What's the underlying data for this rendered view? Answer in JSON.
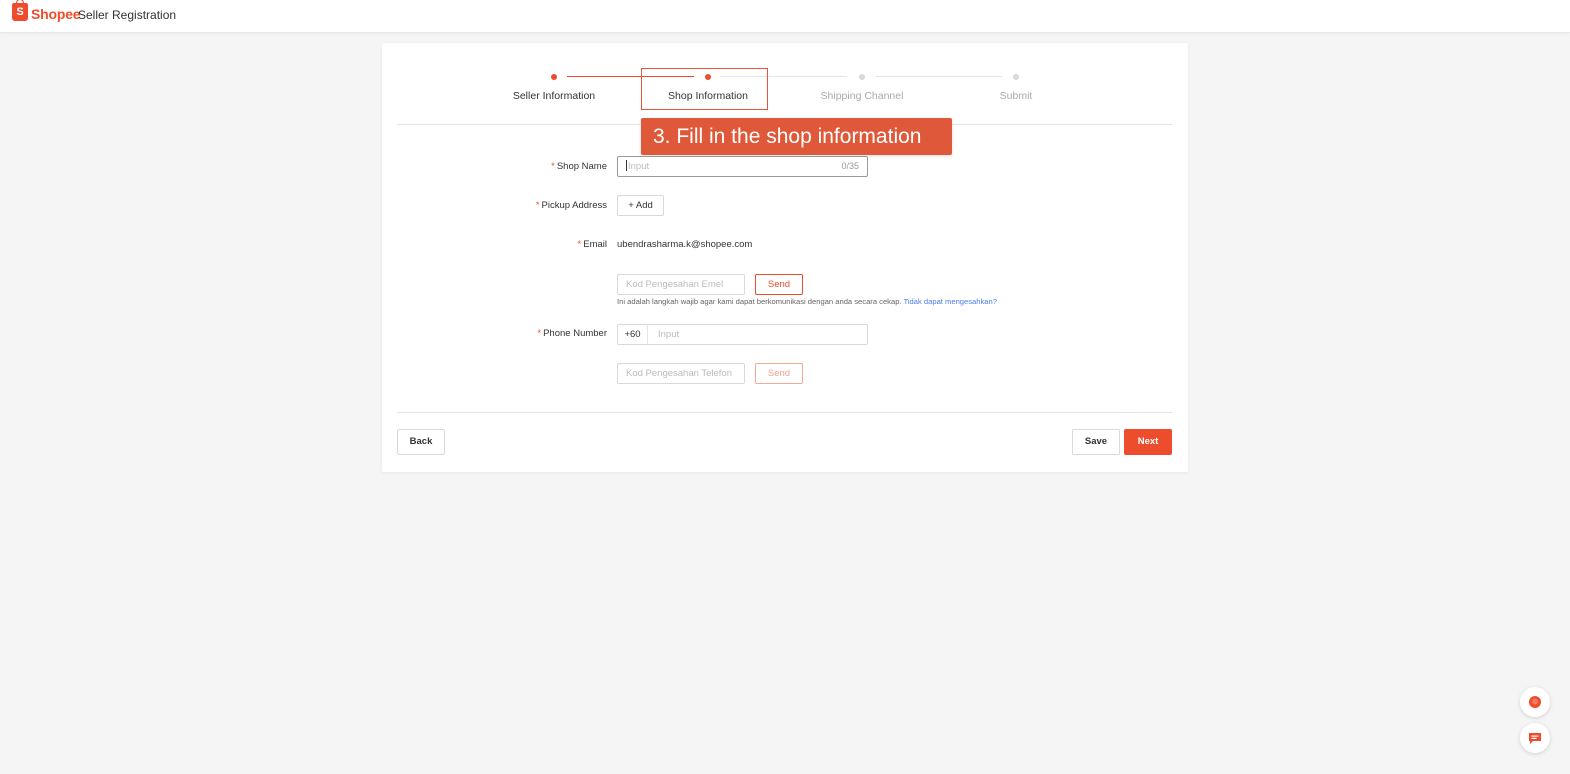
{
  "header": {
    "logo_mark": "S",
    "logo_text": "Shopee",
    "title": "Seller Registration"
  },
  "steps": [
    {
      "label": "Seller Information",
      "state": "done"
    },
    {
      "label": "Shop Information",
      "state": "active"
    },
    {
      "label": "Shipping Channel",
      "state": "pending"
    },
    {
      "label": "Submit",
      "state": "pending"
    }
  ],
  "callout": {
    "text": "3. Fill in the shop information"
  },
  "form": {
    "shop_name": {
      "label": "Shop Name",
      "placeholder": "Input",
      "counter": "0/35"
    },
    "pickup_address": {
      "label": "Pickup Address",
      "add_label": "+ Add"
    },
    "email": {
      "label": "Email",
      "value": "ubendrasharma.k@shopee.com",
      "code_placeholder": "Kod Pengesahan Emel",
      "send_label": "Send",
      "hint": "Ini adalah langkah wajib agar kami dapat berkomunikasi dengan anda secara cekap.",
      "hint_link": "Tidak dapat mengesahkan?"
    },
    "phone": {
      "label": "Phone Number",
      "prefix": "+60",
      "placeholder": "Input",
      "code_placeholder": "Kod Pengesahan Telefon",
      "send_label": "Send"
    },
    "required_mark": "*"
  },
  "footer": {
    "back_label": "Back",
    "save_label": "Save",
    "next_label": "Next"
  },
  "colors": {
    "accent": "#ee4d2d",
    "callout": "#e0583a",
    "link": "#4a7ee8"
  },
  "icons": {
    "chat_bubble": "chat-bubble-icon",
    "message": "message-icon"
  }
}
